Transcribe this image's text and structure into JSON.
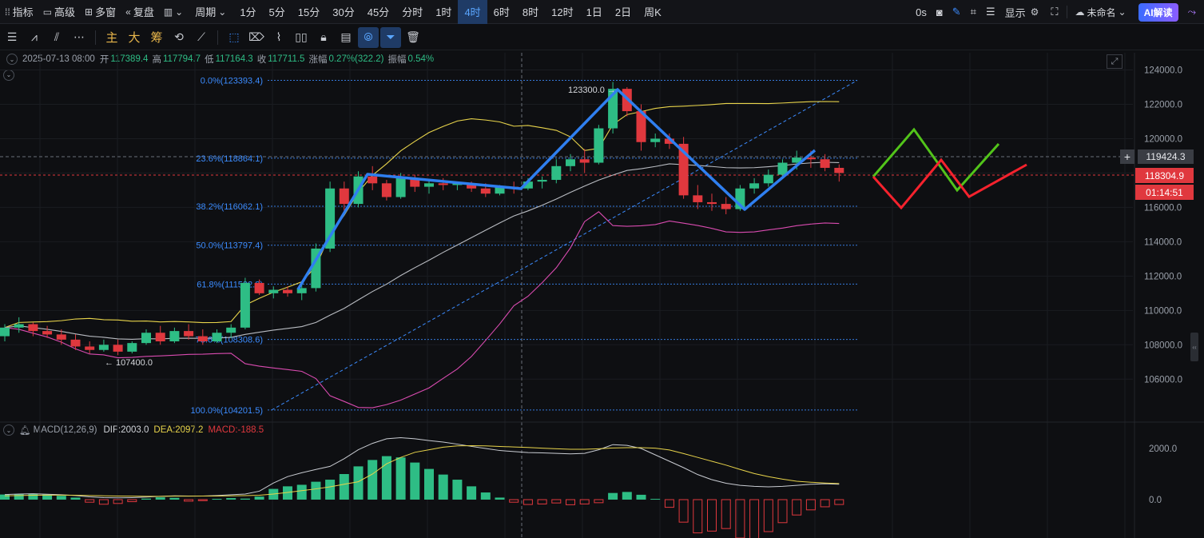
{
  "toolbar": {
    "indicators": "指标",
    "advanced": "高级",
    "multi_window": "多窗",
    "replay": "复盘",
    "period": "周期",
    "periods": [
      "1分",
      "5分",
      "15分",
      "30分",
      "45分",
      "分时",
      "1时",
      "4时",
      "6时",
      "8时",
      "12时",
      "1日",
      "2日",
      "周K"
    ],
    "active_period": "4时",
    "timer": "0s",
    "display": "显示",
    "unnamed": "未命名",
    "ai": "AI解读"
  },
  "drawbar": {
    "main": "主",
    "big": "大",
    "chip": "筹"
  },
  "info": {
    "datetime": "2025-07-13 08:00",
    "open_label": "开",
    "open": "117389.4",
    "high_label": "高",
    "high": "117794.7",
    "low_label": "低",
    "low": "117164.3",
    "close_label": "收",
    "close": "117711.5",
    "change_label": "涨幅",
    "change": "0.27%(322.2)",
    "amp_label": "振幅",
    "amp": "0.54%"
  },
  "macd": {
    "name": "MACD(12,26,9)",
    "dif_label": "DIF:",
    "dif": "2003.0",
    "dea_label": "DEA:",
    "dea": "2097.2",
    "macd_label": "MACD:",
    "macd": "-188.5"
  },
  "price_axis": {
    "ticks": [
      "124000.0",
      "122000.0",
      "120000.0",
      "118000.0",
      "116000.0",
      "114000.0",
      "112000.0",
      "110000.0",
      "108000.0",
      "106000.0"
    ],
    "crosshair_price": "119424.3",
    "last_price": "118304.9",
    "countdown": "01:14:51",
    "macd_ticks": [
      "2000.0",
      "0.0"
    ]
  },
  "fib": {
    "levels": [
      {
        "label": "0.0%(123393.4)",
        "price": 123393.4
      },
      {
        "label": "23.6%(118864.1)",
        "price": 118864.1
      },
      {
        "label": "38.2%(116062.1)",
        "price": 116062.1
      },
      {
        "label": "50.0%(113797.4)",
        "price": 113797.4
      },
      {
        "label": "61.8%(111532.8)",
        "price": 111532.8
      },
      {
        "label": "78.6%(108308.6)",
        "price": 108308.6
      },
      {
        "label": "100.0%(104201.5)",
        "price": 104201.5
      }
    ]
  },
  "annotations": {
    "high_mark": "123300.0",
    "low_mark": "107400.0"
  },
  "chart_data": {
    "type": "candlestick",
    "title": "",
    "ylim": [
      103500,
      125000
    ],
    "colors": {
      "up": "#2ebd85",
      "down": "#e0383e"
    },
    "candles": [
      [
        108500,
        109200,
        108200,
        109000
      ],
      [
        109000,
        109600,
        108700,
        109200
      ],
      [
        109200,
        109300,
        108500,
        108800
      ],
      [
        108800,
        109100,
        108400,
        108600
      ],
      [
        108600,
        108900,
        108000,
        108300
      ],
      [
        108300,
        108600,
        107700,
        107900
      ],
      [
        107900,
        108200,
        107500,
        107700
      ],
      [
        107700,
        108300,
        107600,
        108000
      ],
      [
        108000,
        108300,
        107400,
        107600
      ],
      [
        107600,
        108200,
        107500,
        108100
      ],
      [
        108100,
        108900,
        108000,
        108700
      ],
      [
        108700,
        109100,
        108000,
        108200
      ],
      [
        108200,
        109000,
        108100,
        108800
      ],
      [
        108800,
        109200,
        108300,
        108500
      ],
      [
        108500,
        108900,
        108000,
        108200
      ],
      [
        108200,
        108900,
        108100,
        108700
      ],
      [
        108700,
        109200,
        108400,
        109000
      ],
      [
        109000,
        111900,
        108900,
        111600
      ],
      [
        111600,
        111800,
        110900,
        111000
      ],
      [
        111000,
        111400,
        110700,
        111200
      ],
      [
        111200,
        111400,
        110800,
        111000
      ],
      [
        111000,
        111600,
        110600,
        111300
      ],
      [
        111300,
        113900,
        111100,
        113600
      ],
      [
        113600,
        117500,
        113400,
        117100
      ],
      [
        117100,
        117500,
        115800,
        116200
      ],
      [
        116200,
        118100,
        116000,
        117800
      ],
      [
        117800,
        118400,
        117000,
        117400
      ],
      [
        117400,
        117600,
        116400,
        116600
      ],
      [
        116600,
        118000,
        116500,
        117700
      ],
      [
        117700,
        117900,
        116900,
        117200
      ],
      [
        117200,
        117600,
        116800,
        117400
      ],
      [
        117400,
        117700,
        117000,
        117300
      ],
      [
        117300,
        117500,
        117000,
        117400
      ],
      [
        117400,
        117500,
        116900,
        117100
      ],
      [
        117100,
        117400,
        116600,
        116800
      ],
      [
        116800,
        117300,
        116700,
        117200
      ],
      [
        117200,
        117500,
        116800,
        117100
      ],
      [
        117100,
        117700,
        117000,
        117500
      ],
      [
        117500,
        117800,
        117100,
        117600
      ],
      [
        117600,
        118800,
        117400,
        118400
      ],
      [
        118400,
        119100,
        118100,
        118800
      ],
      [
        118800,
        119400,
        118000,
        118600
      ],
      [
        118600,
        120800,
        118500,
        120600
      ],
      [
        120600,
        123300,
        120300,
        122900
      ],
      [
        122900,
        123000,
        121300,
        121600
      ],
      [
        121600,
        122000,
        119300,
        119800
      ],
      [
        119800,
        120300,
        119500,
        120000
      ],
      [
        120000,
        120300,
        119400,
        119700
      ],
      [
        119700,
        120100,
        116500,
        116700
      ],
      [
        116700,
        117300,
        115900,
        116300
      ],
      [
        116300,
        116800,
        115800,
        116200
      ],
      [
        116200,
        116600,
        115600,
        115900
      ],
      [
        115900,
        117300,
        115800,
        117100
      ],
      [
        117100,
        117700,
        116800,
        117400
      ],
      [
        117400,
        118200,
        117200,
        117900
      ],
      [
        117900,
        118800,
        117700,
        118600
      ],
      [
        118600,
        119300,
        118200,
        118900
      ],
      [
        118900,
        119300,
        118300,
        118800
      ],
      [
        118800,
        119100,
        118100,
        118300
      ],
      [
        118300,
        118500,
        117500,
        118000
      ]
    ],
    "macd": {
      "hist": [
        200,
        220,
        230,
        200,
        150,
        80,
        -100,
        -180,
        -150,
        -80,
        40,
        90,
        70,
        -60,
        -40,
        30,
        60,
        40,
        120,
        420,
        520,
        580,
        700,
        780,
        1000,
        1300,
        1550,
        1700,
        1650,
        1450,
        1200,
        980,
        780,
        520,
        280,
        80,
        -100,
        -190,
        -170,
        -130,
        -200,
        -170,
        -120,
        260,
        300,
        190,
        30,
        -300,
        -880,
        -1300,
        -1230,
        -1130,
        -1500,
        -1650,
        -1250,
        -900,
        -600,
        -400,
        -280,
        -190
      ],
      "dif": [
        200,
        220,
        230,
        210,
        190,
        160,
        110,
        80,
        70,
        80,
        100,
        130,
        150,
        140,
        140,
        160,
        190,
        220,
        330,
        650,
        900,
        1050,
        1180,
        1300,
        1600,
        1950,
        2200,
        2380,
        2420,
        2380,
        2310,
        2250,
        2170,
        2080,
        2000,
        1920,
        1880,
        1840,
        1830,
        1810,
        1790,
        1810,
        1950,
        2150,
        2120,
        2000,
        1750,
        1500,
        1250,
        980,
        780,
        640,
        560,
        520,
        500,
        520,
        560,
        600,
        620,
        600
      ],
      "dea": [
        150,
        160,
        170,
        175,
        175,
        170,
        160,
        150,
        140,
        135,
        130,
        130,
        135,
        138,
        140,
        142,
        147,
        155,
        170,
        220,
        280,
        350,
        420,
        500,
        600,
        700,
        1000,
        1400,
        1650,
        1850,
        1950,
        2050,
        2100,
        2110,
        2100,
        2080,
        2060,
        2040,
        2010,
        1990,
        1970,
        1970,
        1990,
        2020,
        2030,
        2030,
        2010,
        1940,
        1800,
        1650,
        1500,
        1350,
        1180,
        1020,
        900,
        800,
        720,
        680,
        650,
        630
      ]
    }
  }
}
